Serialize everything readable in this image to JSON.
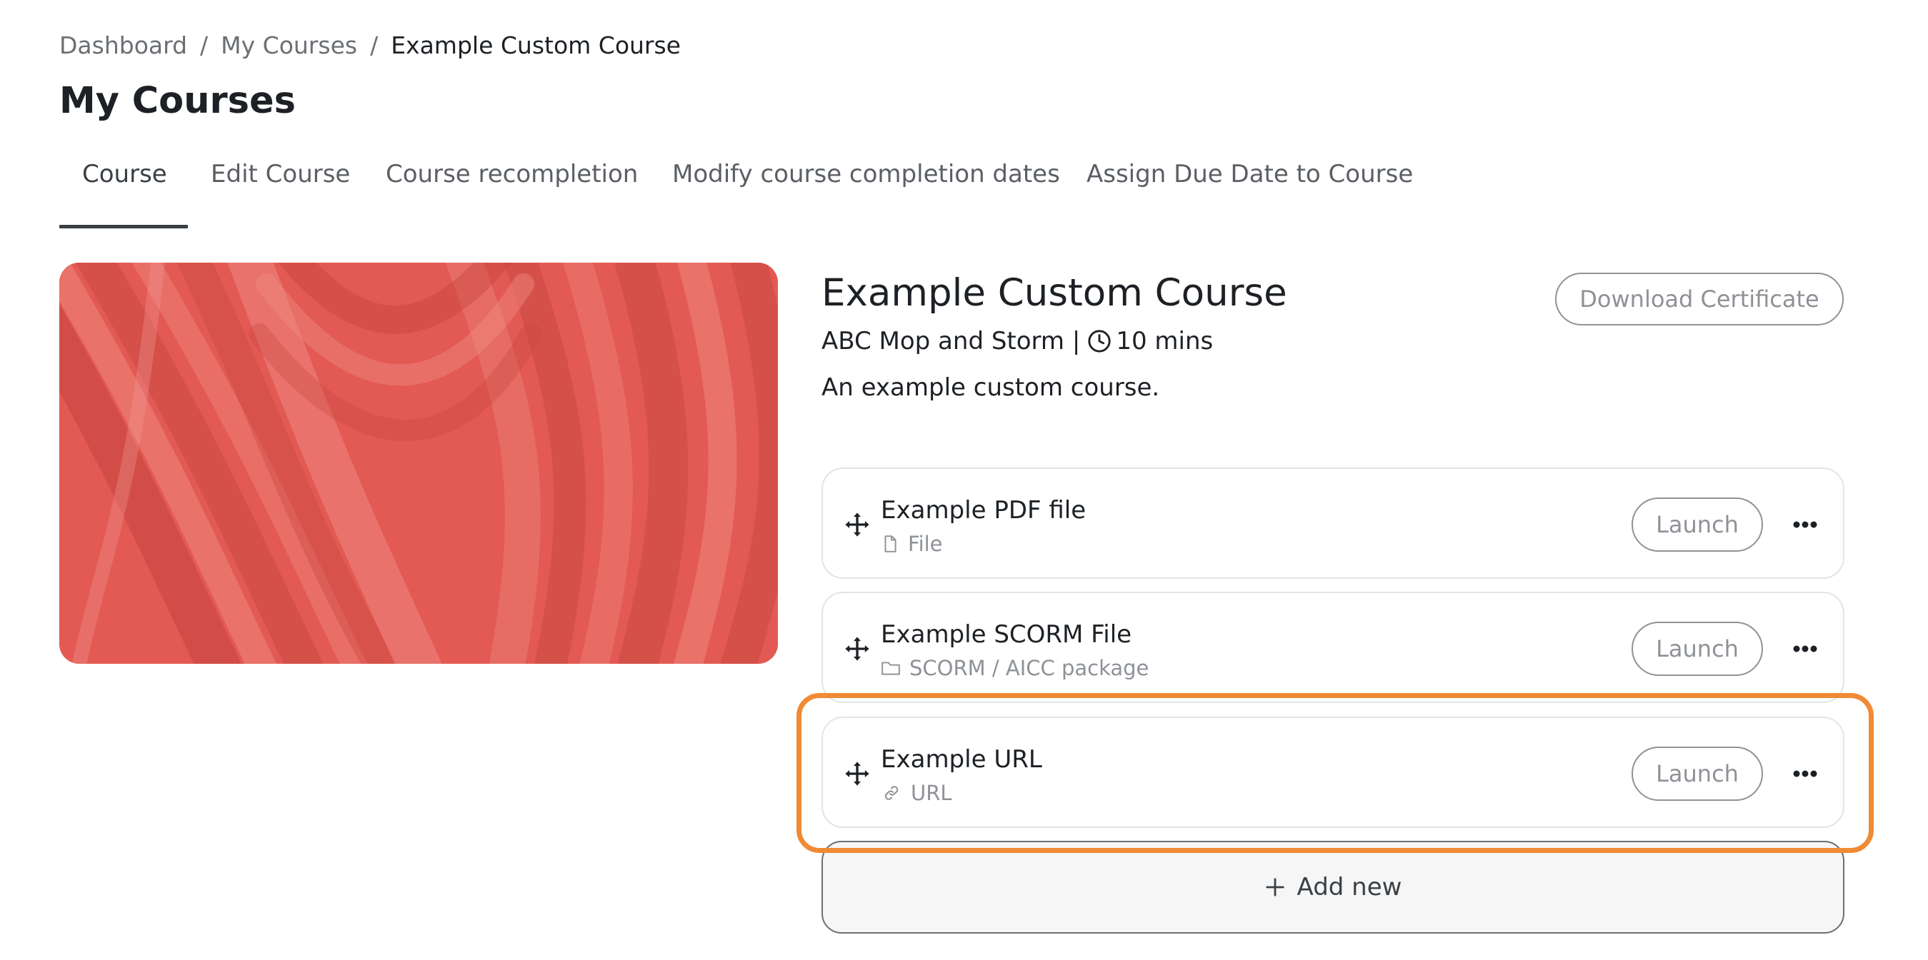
{
  "breadcrumb": {
    "items": [
      "Dashboard",
      "My Courses"
    ],
    "separator": "/",
    "current": "Example Custom Course"
  },
  "page_title": "My Courses",
  "tabs": [
    {
      "label": "Course",
      "active": true
    },
    {
      "label": "Edit Course",
      "active": false
    },
    {
      "label": "Course recompletion",
      "active": false
    },
    {
      "label": "Modify course completion dates",
      "active": false
    },
    {
      "label": "Assign Due Date to Course",
      "active": false
    }
  ],
  "course": {
    "name": "Example Custom Course",
    "provider": "ABC Mop and Storm |",
    "duration": "10 mins",
    "description": "An example custom course.",
    "download_label": "Download Certificate",
    "image_colors": {
      "base": "#e25a53",
      "dark": "#c8453f",
      "light": "#f08a80"
    }
  },
  "activities": [
    {
      "title": "Example PDF file",
      "type": "File",
      "type_icon": "file-icon",
      "launch_label": "Launch",
      "highlighted": false
    },
    {
      "title": "Example SCORM File",
      "type": "SCORM / AICC package",
      "type_icon": "folder-icon",
      "launch_label": "Launch",
      "highlighted": false
    },
    {
      "title": "Example URL",
      "type": "URL",
      "type_icon": "link-icon",
      "launch_label": "Launch",
      "highlighted": true
    }
  ],
  "add_new_label": "Add new",
  "colors": {
    "highlight": "#f08a34",
    "text": "#1d2125",
    "muted": "#8e9297"
  }
}
